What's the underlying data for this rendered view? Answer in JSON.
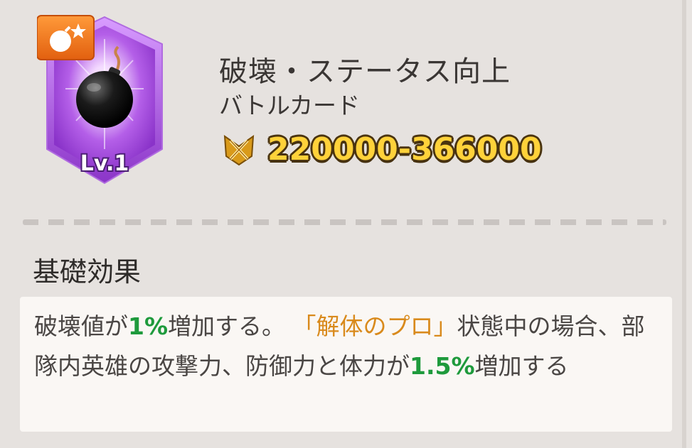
{
  "card": {
    "level_label": "Lv.1",
    "category_icon": "bomb-star-icon",
    "main_icon": "bomb-icon"
  },
  "header": {
    "title": "破壊・ステータス向上",
    "subtitle": "バトルカード",
    "power_icon": "crossed-swords-icon",
    "power_value": "220000-366000"
  },
  "section": {
    "title": "基礎効果"
  },
  "description": {
    "p1": "破壊値が",
    "v1": "1%",
    "p2": "増加する。",
    "link": "「解体のプロ」",
    "p3": "状態中の場合、部隊内英雄の攻撃力、防御力と体力が",
    "v2": "1.5%",
    "p4": "増加する"
  },
  "colors": {
    "accent_green": "#1e9a3c",
    "link_orange": "#d98a1c",
    "power_gold": "#ffd23a",
    "card_purple": "#b25be6",
    "category_orange": "#f07a1a"
  }
}
